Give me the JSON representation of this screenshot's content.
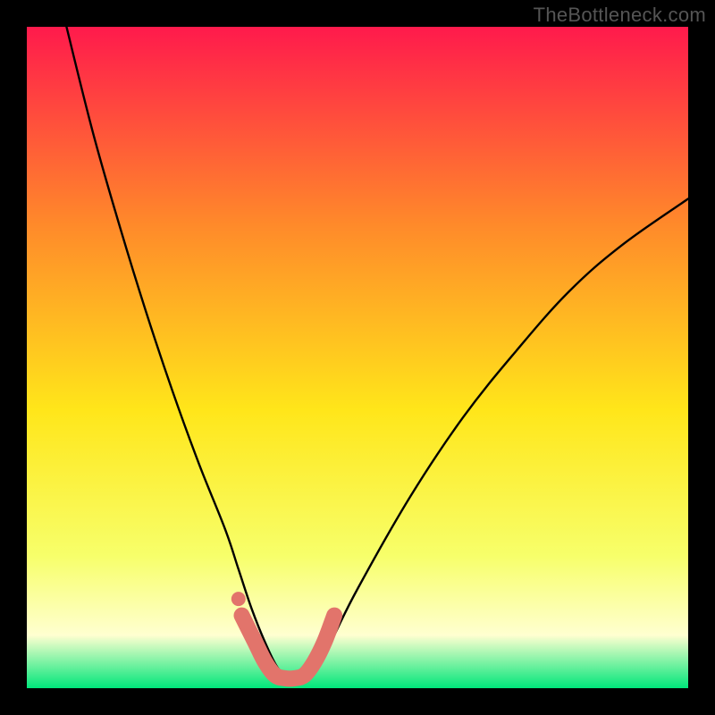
{
  "credit": "TheBottleneck.com",
  "colors": {
    "frame": "#000000",
    "gradient_top": "#ff1a4c",
    "gradient_upper_mid": "#ff8a2a",
    "gradient_mid": "#ffe61a",
    "gradient_lower_mid": "#f7ff6a",
    "gradient_pale": "#ffffd0",
    "gradient_bottom": "#00e67a",
    "curve": "#000000",
    "marker": "#e2746b"
  },
  "chart_data": {
    "type": "line",
    "title": "",
    "xlabel": "",
    "ylabel": "",
    "xlim": [
      0,
      100
    ],
    "ylim": [
      0,
      100
    ],
    "grid": false,
    "legend": false,
    "series": [
      {
        "name": "bottleneck-curve",
        "x": [
          6,
          10,
          14,
          18,
          22,
          26,
          30,
          32,
          34,
          36,
          38,
          40,
          42,
          44,
          46,
          50,
          58,
          66,
          74,
          82,
          90,
          100
        ],
        "y": [
          100,
          84,
          70,
          57,
          45,
          34,
          24,
          18,
          12,
          7,
          3,
          1.5,
          1.5,
          3,
          7,
          15,
          29,
          41,
          51,
          60,
          67,
          74
        ]
      },
      {
        "name": "bottom-markers",
        "x": [
          32.5,
          34.5,
          36,
          37.5,
          39,
          40.5,
          42,
          43.5,
          45,
          46.5
        ],
        "y": [
          11,
          7,
          4,
          2,
          1.5,
          1.5,
          2,
          4,
          7,
          11
        ]
      }
    ]
  }
}
